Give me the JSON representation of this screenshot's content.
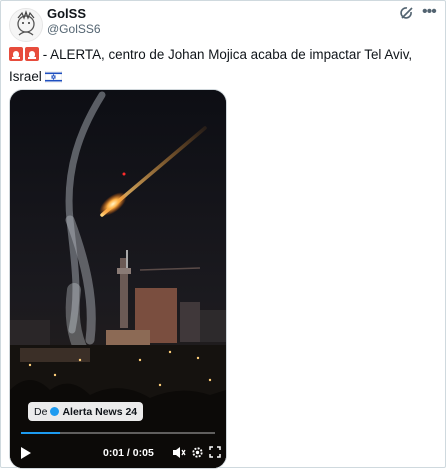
{
  "tweet": {
    "display_name": "GolSS",
    "handle": "@GolSS6",
    "text_part1": " - ALERTA, centro de Johan Mojica acaba de impactar Tel Aviv,",
    "text_part2": "Israel",
    "icons": [
      "siren-icon",
      "siren-icon",
      "israel-flag-icon",
      "grok-icon",
      "more-icon"
    ]
  },
  "video": {
    "source_prefix": "De",
    "source_name": "Alerta News 24",
    "time": "0:01 / 0:05",
    "progress": 0.2,
    "controls": [
      "play-icon",
      "mute-icon",
      "settings-icon",
      "fullscreen-icon"
    ]
  },
  "colors": {
    "accent": "#1d9bf0",
    "text": "#0f1419",
    "muted": "#536471",
    "border": "#cfd9de"
  }
}
